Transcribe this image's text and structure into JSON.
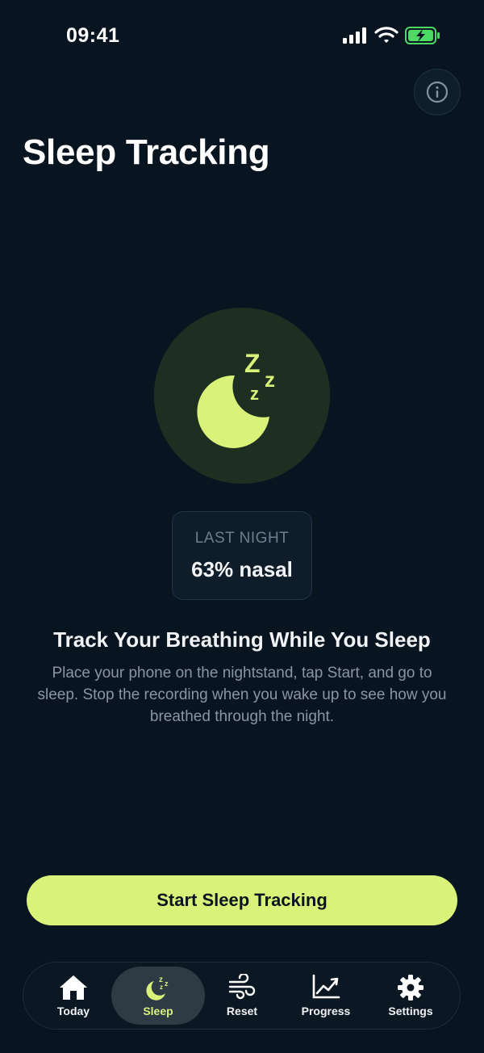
{
  "status_bar": {
    "time": "09:41"
  },
  "header": {
    "title": "Sleep Tracking"
  },
  "colors": {
    "background": "#081520",
    "accent": "#d8f27a",
    "moon_circle": "#1e2f22"
  },
  "summary": {
    "label": "LAST NIGHT",
    "value": "63% nasal"
  },
  "intro": {
    "heading": "Track Your Breathing While You Sleep",
    "description": "Place your phone on the nightstand, tap Start, and go to sleep. Stop the recording when you wake up to see how you breathed through the night."
  },
  "actions": {
    "start_label": "Start Sleep Tracking"
  },
  "tabs": [
    {
      "label": "Today",
      "icon": "home-icon"
    },
    {
      "label": "Sleep",
      "icon": "moon-zzz-icon",
      "active": true
    },
    {
      "label": "Reset",
      "icon": "wind-icon"
    },
    {
      "label": "Progress",
      "icon": "chart-icon"
    },
    {
      "label": "Settings",
      "icon": "gear-icon"
    }
  ]
}
